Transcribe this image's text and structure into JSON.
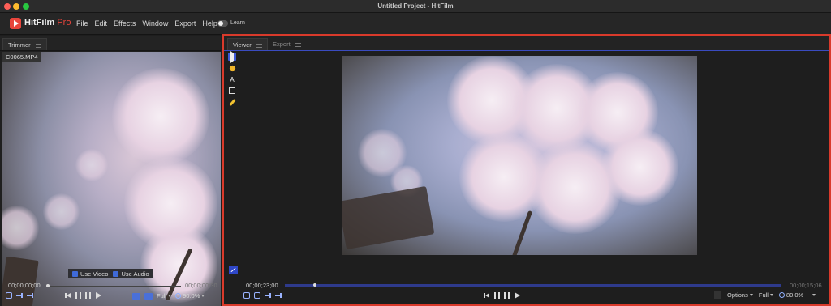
{
  "window": {
    "title": "Untitled Project - HitFilm"
  },
  "app": {
    "logo_main": "HitFilm",
    "logo_pro": "Pro"
  },
  "menu": {
    "items": [
      "File",
      "Edit",
      "Effects",
      "Window",
      "Export",
      "Help"
    ],
    "learn_label": "Learn"
  },
  "trimmer": {
    "tab_label": "Trimmer",
    "clip_name": "C0065.MP4",
    "use_video": "Use Video",
    "use_audio": "Use Audio",
    "time_current": "00;00;00;00",
    "time_end": "00;00;00;30",
    "quality": "Full",
    "zoom": "90.0%"
  },
  "viewer": {
    "tabs": [
      {
        "label": "Viewer",
        "active": true
      },
      {
        "label": "Export",
        "active": false
      }
    ],
    "time_current": "00;00;23;00",
    "time_end": "00;00;15;06",
    "options_label": "Options",
    "quality": "Full",
    "zoom": "80.0%",
    "tool_text_glyph": "A",
    "playhead_fraction": 0.06
  },
  "colors": {
    "accent_blue": "#3c57d8",
    "highlight_red": "#d93a2b",
    "brand_red": "#e8453c"
  }
}
